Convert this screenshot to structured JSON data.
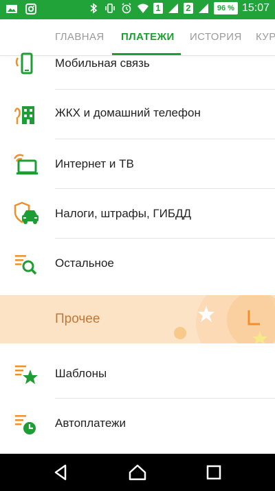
{
  "status_bar": {
    "sim1": "1",
    "sim2": "2",
    "battery": "96 %",
    "time": "15:07"
  },
  "tabs": [
    {
      "label": "ГЛАВНАЯ"
    },
    {
      "label": "ПЛАТЕЖИ"
    },
    {
      "label": "ИСТОРИЯ"
    },
    {
      "label": "КУР"
    }
  ],
  "payments": [
    {
      "label": "Мобильная связь",
      "icon": "mobile-phone-icon"
    },
    {
      "label": "ЖКХ и домашний телефон",
      "icon": "house-icon"
    },
    {
      "label": "Интернет и ТВ",
      "icon": "internet-tv-icon"
    },
    {
      "label": "Налоги, штрафы, ГИБДД",
      "icon": "car-shield-icon"
    },
    {
      "label": "Остальное",
      "icon": "search-list-icon"
    }
  ],
  "other_section": {
    "title": "Прочее",
    "items": [
      {
        "label": "Шаблоны",
        "icon": "star-list-icon"
      },
      {
        "label": "Автоплатежи",
        "icon": "clock-list-icon"
      }
    ]
  },
  "colors": {
    "status_green": "#22a33a",
    "accent_green": "#1e9d35",
    "icon_orange": "#f0902c",
    "section_bg": "#fde3c6",
    "section_text": "#c07838"
  }
}
